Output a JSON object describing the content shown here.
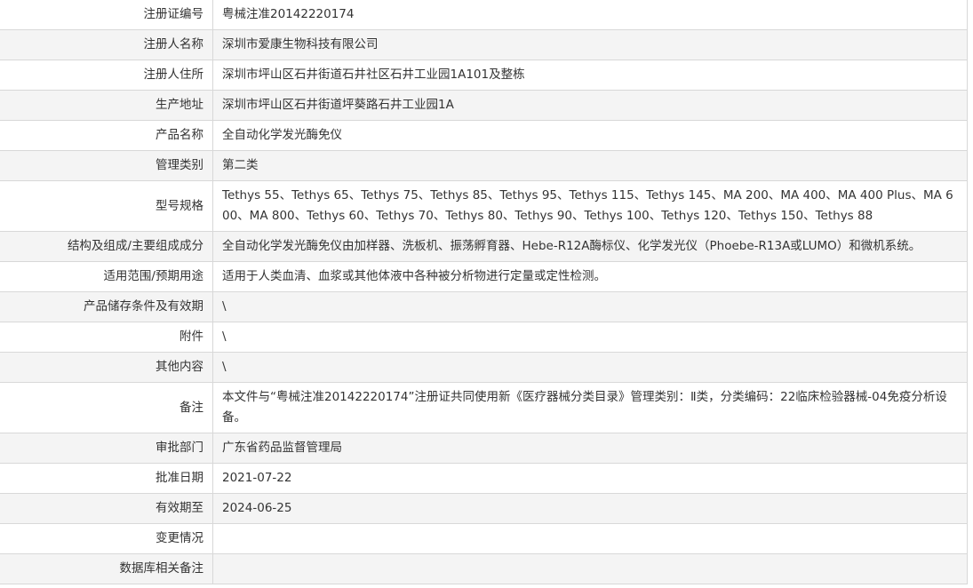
{
  "rows": [
    {
      "label": "注册证编号",
      "value": "粤械注准20142220174"
    },
    {
      "label": "注册人名称",
      "value": "深圳市爱康生物科技有限公司"
    },
    {
      "label": "注册人住所",
      "value": "深圳市坪山区石井街道石井社区石井工业园1A101及整栋"
    },
    {
      "label": "生产地址",
      "value": "深圳市坪山区石井街道坪葵路石井工业园1A"
    },
    {
      "label": "产品名称",
      "value": "全自动化学发光酶免仪"
    },
    {
      "label": "管理类别",
      "value": "第二类"
    },
    {
      "label": "型号规格",
      "value": "Tethys 55、Tethys 65、Tethys 75、Tethys 85、Tethys 95、Tethys 115、Tethys 145、MA 200、MA 400、MA 400 Plus、MA 600、MA 800、Tethys 60、Tethys 70、Tethys 80、Tethys 90、Tethys 100、Tethys 120、Tethys 150、Tethys 88"
    },
    {
      "label": "结构及组成/主要组成成分",
      "value": "全自动化学发光酶免仪由加样器、洗板机、振荡孵育器、Hebe-R12A酶标仪、化学发光仪（Phoebe-R13A或LUMO）和微机系统。"
    },
    {
      "label": "适用范围/预期用途",
      "value": "适用于人类血清、血浆或其他体液中各种被分析物进行定量或定性检测。"
    },
    {
      "label": "产品储存条件及有效期",
      "value": "\\"
    },
    {
      "label": "附件",
      "value": "\\"
    },
    {
      "label": "其他内容",
      "value": "\\"
    },
    {
      "label": "备注",
      "value": "本文件与“粤械注准20142220174”注册证共同使用新《医疗器械分类目录》管理类别：Ⅱ类，分类编码：22临床检验器械-04免疫分析设备。"
    },
    {
      "label": "审批部门",
      "value": "广东省药品监督管理局"
    },
    {
      "label": "批准日期",
      "value": "2021-07-22"
    },
    {
      "label": "有效期至",
      "value": "2024-06-25"
    },
    {
      "label": "变更情况",
      "value": ""
    },
    {
      "label": "数据库相关备注",
      "value": ""
    }
  ]
}
